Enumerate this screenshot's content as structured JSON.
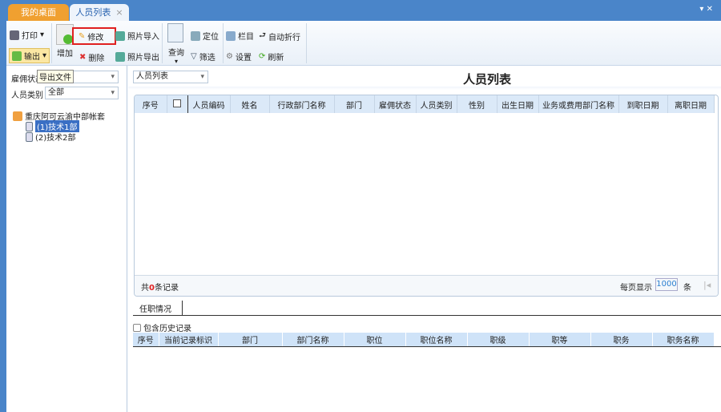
{
  "tabs": [
    {
      "label": "我的桌面"
    },
    {
      "label": "人员列表",
      "close": "×"
    }
  ],
  "window_controls": "▾  ✕",
  "toolbar": {
    "print": "打印",
    "export": "输出",
    "add": "增加",
    "edit": "修改",
    "delete": "删除",
    "photo_import": "照片导入",
    "photo_export": "照片导出",
    "query": "查询",
    "locate": "定位",
    "filter": "筛选",
    "columns": "栏目",
    "settings": "设置",
    "auto_wrap": "自动折行",
    "refresh": "刷新",
    "export_tooltip": "导出文件"
  },
  "left": {
    "employ_status_label": "雇佣状态",
    "employ_status_value": "",
    "person_type_label": "人员类别",
    "person_type_value": "全部",
    "tree_root": "重庆阿可云渝中部帐套",
    "tree_children": [
      "(1)技术1部",
      "(2)技术2部"
    ]
  },
  "main": {
    "view_select": "人员列表",
    "title": "人员列表",
    "columns": [
      "序号",
      "",
      "人员编码",
      "姓名",
      "行政部门名称",
      "部门",
      "雇佣状态",
      "人员类别",
      "性别",
      "出生日期",
      "业务或费用部门名称",
      "到职日期",
      "离职日期"
    ],
    "footer": {
      "prefix": "共",
      "count": "0",
      "suffix": "条记录",
      "page_size_label": "每页显示",
      "page_size": "1000",
      "page_size_unit": "条"
    },
    "sub_tab": "任职情况",
    "history_checkbox": "包含历史记录",
    "sub_columns": [
      "序号",
      "当前记录标识",
      "部门",
      "部门名称",
      "职位",
      "职位名称",
      "职级",
      "职等",
      "职务",
      "职务名称"
    ]
  },
  "colors": {
    "topbar": "#4a85c9",
    "desk_tab": "#f0a030",
    "highlight": "#e02020"
  }
}
